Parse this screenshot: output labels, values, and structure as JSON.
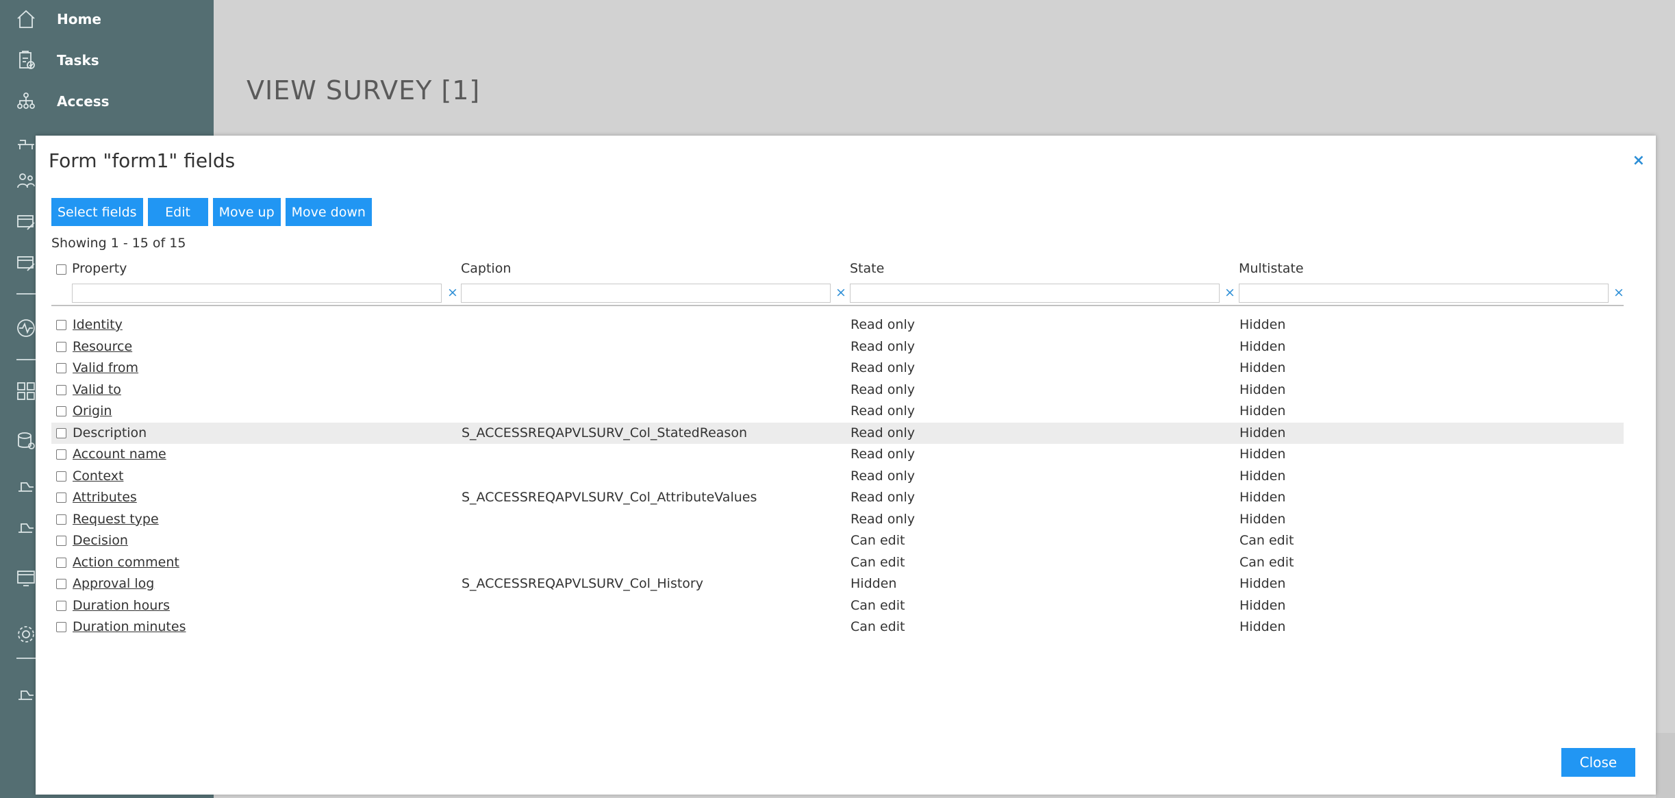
{
  "sidebar": {
    "items": [
      {
        "label": "Home",
        "icon": "home-icon"
      },
      {
        "label": "Tasks",
        "icon": "clipboard-check-icon"
      },
      {
        "label": "Access",
        "icon": "org-chart-icon"
      }
    ],
    "icons_only": [
      "desk-icon",
      "people-icon",
      "card-edit-icon",
      "card-edit-icon-2",
      "activity-icon",
      "grid-icon",
      "database-icon",
      "hand-icon",
      "hand-icon-2",
      "screen-icon",
      "gear-icon",
      "hand-icon-3"
    ]
  },
  "page": {
    "title": "VIEW SURVEY [1]"
  },
  "modal": {
    "title": "Form \"form1\" fields",
    "close_glyph": "×",
    "toolbar": {
      "select_fields": "Select fields",
      "edit": "Edit",
      "move_up": "Move up",
      "move_down": "Move down"
    },
    "showing": "Showing 1 - 15 of 15",
    "columns": {
      "property": "Property",
      "caption": "Caption",
      "state": "State",
      "multistate": "Multistate"
    },
    "filter_clear_glyph": "×",
    "rows": [
      {
        "property": "Identity",
        "link": true,
        "caption": "",
        "state": "Read only",
        "multistate": "Hidden"
      },
      {
        "property": "Resource",
        "link": true,
        "caption": "",
        "state": "Read only",
        "multistate": "Hidden"
      },
      {
        "property": "Valid from",
        "link": true,
        "caption": "",
        "state": "Read only",
        "multistate": "Hidden"
      },
      {
        "property": "Valid to",
        "link": true,
        "caption": "",
        "state": "Read only",
        "multistate": "Hidden"
      },
      {
        "property": "Origin",
        "link": true,
        "caption": "",
        "state": "Read only",
        "multistate": "Hidden"
      },
      {
        "property": "Description",
        "link": false,
        "caption": "S_ACCESSREQAPVLSURV_Col_StatedReason",
        "state": "Read only",
        "multistate": "Hidden",
        "highlighted": true
      },
      {
        "property": "Account name",
        "link": true,
        "caption": "",
        "state": "Read only",
        "multistate": "Hidden"
      },
      {
        "property": "Context",
        "link": true,
        "caption": "",
        "state": "Read only",
        "multistate": "Hidden"
      },
      {
        "property": "Attributes",
        "link": true,
        "caption": "S_ACCESSREQAPVLSURV_Col_AttributeValues",
        "state": "Read only",
        "multistate": "Hidden"
      },
      {
        "property": "Request type",
        "link": true,
        "caption": "",
        "state": "Read only",
        "multistate": "Hidden"
      },
      {
        "property": "Decision",
        "link": true,
        "caption": "",
        "state": "Can edit",
        "multistate": "Can edit"
      },
      {
        "property": "Action comment",
        "link": true,
        "caption": "",
        "state": "Can edit",
        "multistate": "Can edit"
      },
      {
        "property": "Approval log",
        "link": true,
        "caption": "S_ACCESSREQAPVLSURV_Col_History",
        "state": "Hidden",
        "multistate": "Hidden"
      },
      {
        "property": "Duration hours",
        "link": true,
        "caption": "",
        "state": "Can edit",
        "multistate": "Hidden"
      },
      {
        "property": "Duration minutes",
        "link": true,
        "caption": "",
        "state": "Can edit",
        "multistate": "Hidden"
      }
    ],
    "close_label": "Close"
  },
  "colors": {
    "sidebar_bg": "#546e72",
    "accent": "#2196f3",
    "link_x": "#2c8ed6",
    "highlight_row": "#ececec"
  }
}
